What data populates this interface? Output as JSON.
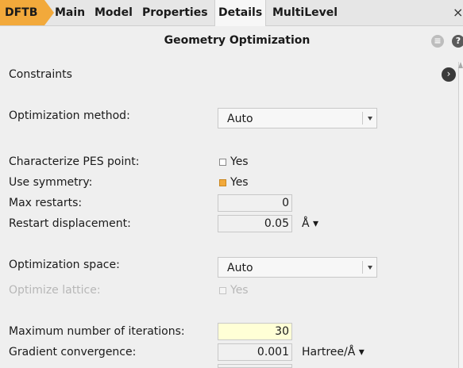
{
  "tabs": {
    "app": "DFTB",
    "main": "Main",
    "model": "Model",
    "properties": "Properties",
    "details": "Details",
    "multilevel": "MultiLevel",
    "close": "×"
  },
  "header": {
    "title": "Geometry Optimization",
    "menu_icon": "≡",
    "help_icon": "?"
  },
  "sections": {
    "constraints": "Constraints",
    "nav": "›"
  },
  "fields": {
    "optimization_method": {
      "label": "Optimization method:",
      "value": "Auto"
    },
    "characterize_pes": {
      "label": "Characterize PES point:",
      "check_label": "Yes",
      "checked": false
    },
    "use_symmetry": {
      "label": "Use symmetry:",
      "check_label": "Yes",
      "checked": true
    },
    "max_restarts": {
      "label": "Max restarts:",
      "value": "0"
    },
    "restart_displacement": {
      "label": "Restart displacement:",
      "value": "0.05",
      "unit": "Å ▾"
    },
    "optimization_space": {
      "label": "Optimization space:",
      "value": "Auto"
    },
    "optimize_lattice": {
      "label": "Optimize lattice:",
      "check_label": "Yes",
      "checked": false,
      "disabled": true
    },
    "max_iterations": {
      "label": "Maximum number of iterations:",
      "value": "30"
    },
    "gradient_convergence": {
      "label": "Gradient convergence:",
      "value": "0.001",
      "unit": "Hartree/Å ▾"
    }
  },
  "colors": {
    "accent": "#f2a93b",
    "highlight_field": "#ffffd6",
    "background": "#efefef"
  }
}
